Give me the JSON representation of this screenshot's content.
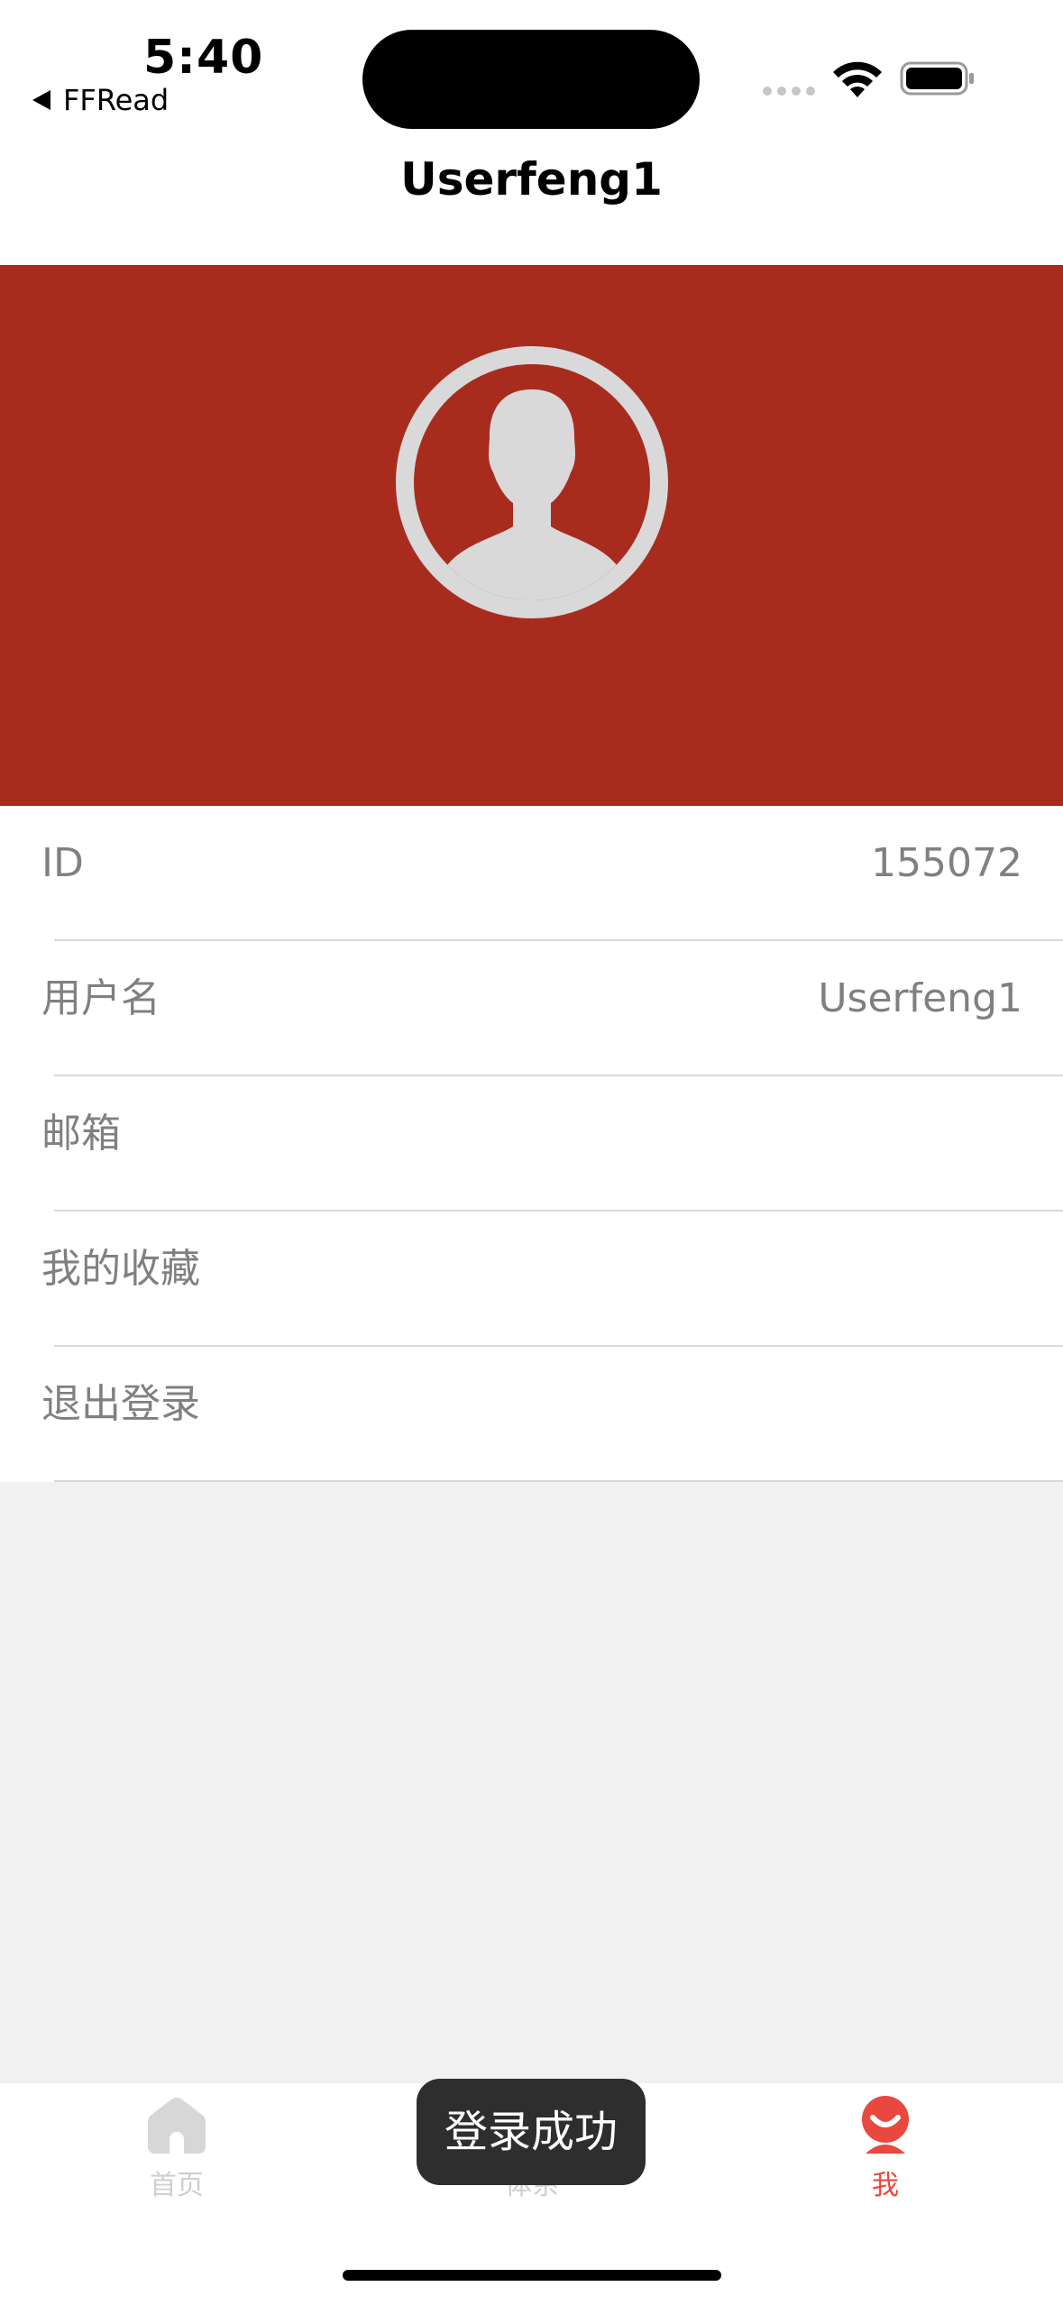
{
  "status_bar": {
    "time": "5:40",
    "back_app": "FFRead",
    "icons": [
      "signal-dots-icon",
      "wifi-icon",
      "battery-icon"
    ]
  },
  "nav": {
    "title": "Userfeng1"
  },
  "banner": {
    "color": "#a82c1e",
    "avatar_icon": "default-avatar-icon"
  },
  "profile_rows": [
    {
      "label": "ID",
      "value": "155072"
    },
    {
      "label": "用户名",
      "value": "Userfeng1"
    },
    {
      "label": "邮箱",
      "value": ""
    },
    {
      "label": "我的收藏",
      "value": ""
    },
    {
      "label": "退出登录",
      "value": ""
    }
  ],
  "tabs": [
    {
      "label": "首页",
      "icon": "home-icon",
      "active": false
    },
    {
      "label": "体系",
      "icon": "system-icon",
      "active": false
    },
    {
      "label": "我",
      "icon": "me-icon",
      "active": true
    }
  ],
  "toast": {
    "text": "登录成功"
  },
  "colors": {
    "accent": "#e8483e",
    "banner": "#a82c1e",
    "inactive": "#cfcfcf"
  }
}
